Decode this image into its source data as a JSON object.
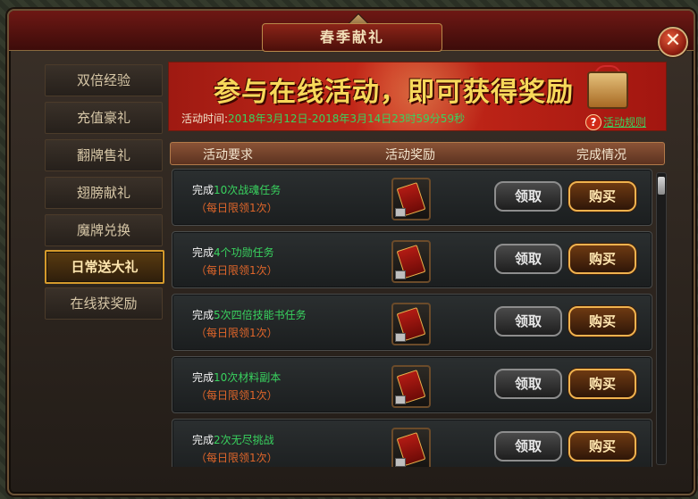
{
  "window": {
    "title": "春季献礼",
    "close_label": "✕"
  },
  "sidebar": {
    "items": [
      {
        "label": "双倍经验"
      },
      {
        "label": "充值豪礼"
      },
      {
        "label": "翻牌售礼"
      },
      {
        "label": "翅膀献礼"
      },
      {
        "label": "魔牌兑换"
      },
      {
        "label": "日常送大礼"
      },
      {
        "label": "在线获奖励"
      }
    ],
    "active_index": 5
  },
  "banner": {
    "title": "参与在线活动，即可获得奖励",
    "time_label": "活动时间:",
    "time_value": "2018年3月12日-2018年3月14日23时59分59秒",
    "rules_label": "活动规则",
    "help_icon": "?"
  },
  "table": {
    "headers": [
      "活动要求",
      "活动奖励",
      "完成情况"
    ],
    "rows": [
      {
        "prefix": "完成",
        "num": "10次",
        "task": "战魂任务",
        "limit": "（每日限领1次）",
        "claim": "领取",
        "buy": "购买"
      },
      {
        "prefix": "完成",
        "num": "4个",
        "task": "功勋任务",
        "limit": "（每日限领1次）",
        "claim": "领取",
        "buy": "购买"
      },
      {
        "prefix": "完成",
        "num": "5次",
        "task": "四倍技能书任务",
        "limit": "（每日限领1次）",
        "claim": "领取",
        "buy": "购买"
      },
      {
        "prefix": "完成",
        "num": "10次",
        "task": "材料副本",
        "limit": "（每日限领1次）",
        "claim": "领取",
        "buy": "购买"
      },
      {
        "prefix": "完成",
        "num": "2次",
        "task": "无尽挑战",
        "limit": "（每日限领1次）",
        "claim": "领取",
        "buy": "购买"
      }
    ]
  }
}
